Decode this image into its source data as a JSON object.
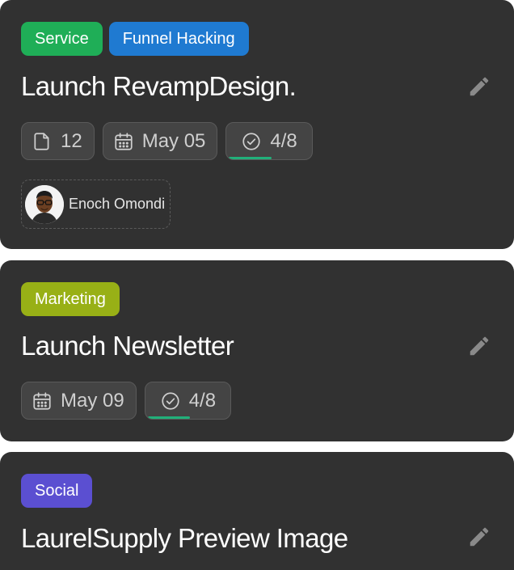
{
  "cards": [
    {
      "tags": [
        {
          "label": "Service",
          "color": "#1fae57"
        },
        {
          "label": "Funnel Hacking",
          "color": "#1f7ad1"
        }
      ],
      "title": "Launch RevampDesign.",
      "edit_icon": "pencil-icon",
      "files_count": "12",
      "due_date": "May 05",
      "checklist": {
        "label": "4/8",
        "done": 4,
        "total": 8
      },
      "assignee": {
        "name": "Enoch Omondi"
      }
    },
    {
      "tags": [
        {
          "label": "Marketing",
          "color": "#98b016"
        }
      ],
      "title": "Launch Newsletter",
      "edit_icon": "pencil-icon",
      "due_date": "May 09",
      "checklist": {
        "label": "4/8",
        "done": 4,
        "total": 8
      }
    },
    {
      "tags": [
        {
          "label": "Social",
          "color": "#5b4fd1"
        }
      ],
      "title": "LaurelSupply Preview Image",
      "edit_icon": "pencil-icon"
    }
  ],
  "colors": {
    "card_background": "#313131",
    "chip_background": "#444444",
    "progress": "#21b07a"
  }
}
